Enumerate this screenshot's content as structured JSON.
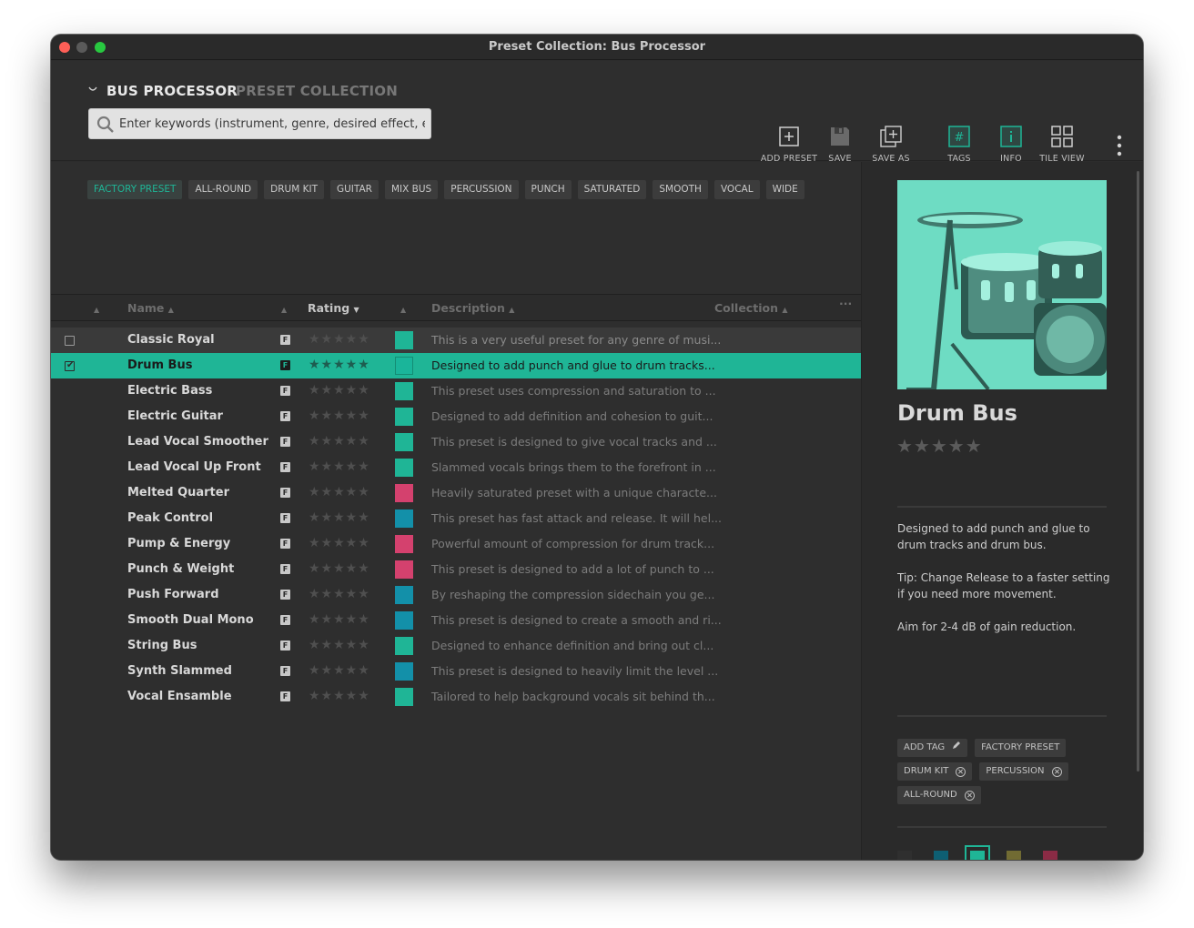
{
  "window": {
    "title": "Preset Collection: Bus Processor"
  },
  "header": {
    "product_name": "BUS PROCESSOR",
    "product_sub": "PRESET COLLECTION",
    "search_placeholder": "Enter keywords (instrument, genre, desired effect, etc.)"
  },
  "toolbar": {
    "add_preset": "ADD PRESET",
    "save": "SAVE",
    "save_as": "SAVE AS",
    "tags": "TAGS",
    "info": "INFO",
    "tile_view": "TILE VIEW"
  },
  "tag_filters": [
    {
      "label": "FACTORY PRESET",
      "active": true
    },
    {
      "label": "ALL-ROUND",
      "active": false
    },
    {
      "label": "DRUM KIT",
      "active": false
    },
    {
      "label": "GUITAR",
      "active": false
    },
    {
      "label": "MIX BUS",
      "active": false
    },
    {
      "label": "PERCUSSION",
      "active": false
    },
    {
      "label": "PUNCH",
      "active": false
    },
    {
      "label": "SATURATED",
      "active": false
    },
    {
      "label": "SMOOTH",
      "active": false
    },
    {
      "label": "VOCAL",
      "active": false
    },
    {
      "label": "WIDE",
      "active": false
    }
  ],
  "table": {
    "columns": {
      "name": "Name",
      "rating": "Rating",
      "description": "Description",
      "collection": "Collection"
    },
    "rows": [
      {
        "name": "Classic Royal",
        "badge": "F",
        "color": "#1fb596",
        "desc": "This is a very useful preset for any genre of musi...",
        "state": "hover",
        "checked": false
      },
      {
        "name": "Drum Bus",
        "badge": "F",
        "color": "#1ab59a",
        "desc": "Designed to add punch and glue to drum tracks...",
        "state": "selected",
        "checked": true
      },
      {
        "name": "Electric Bass",
        "badge": "F",
        "color": "#1fb596",
        "desc": "This preset uses compression and saturation to ...",
        "state": "",
        "checked": false
      },
      {
        "name": "Electric Guitar",
        "badge": "F",
        "color": "#1fb596",
        "desc": "Designed to add definition and cohesion to guit...",
        "state": "",
        "checked": false
      },
      {
        "name": "Lead Vocal Smoother",
        "badge": "F",
        "color": "#1fb596",
        "desc": "This preset is designed to give vocal tracks and ...",
        "state": "",
        "checked": false
      },
      {
        "name": "Lead Vocal Up Front",
        "badge": "F",
        "color": "#1fb596",
        "desc": "Slammed vocals brings them to the forefront in ...",
        "state": "",
        "checked": false
      },
      {
        "name": "Melted Quarter",
        "badge": "F",
        "color": "#d4416e",
        "desc": "Heavily saturated preset with a unique characte...",
        "state": "",
        "checked": false
      },
      {
        "name": "Peak Control",
        "badge": "F",
        "color": "#1390a9",
        "desc": "This preset has fast attack and release. It will hel...",
        "state": "",
        "checked": false
      },
      {
        "name": "Pump & Energy",
        "badge": "F",
        "color": "#d4416e",
        "desc": "Powerful amount of compression for drum track...",
        "state": "",
        "checked": false
      },
      {
        "name": "Punch & Weight",
        "badge": "F",
        "color": "#d4416e",
        "desc": "This preset is designed to add a lot of punch to ...",
        "state": "",
        "checked": false
      },
      {
        "name": "Push Forward",
        "badge": "F",
        "color": "#1390a9",
        "desc": "By reshaping the compression sidechain you ge...",
        "state": "",
        "checked": false
      },
      {
        "name": "Smooth Dual Mono",
        "badge": "F",
        "color": "#1390a9",
        "desc": "This preset is designed to create a smooth and ri...",
        "state": "",
        "checked": false
      },
      {
        "name": "String Bus",
        "badge": "F",
        "color": "#1fb596",
        "desc": "Designed to enhance definition and bring out cl...",
        "state": "",
        "checked": false
      },
      {
        "name": "Synth Slammed",
        "badge": "F",
        "color": "#1390a9",
        "desc": "This preset is designed to heavily limit the level ...",
        "state": "",
        "checked": false
      },
      {
        "name": "Vocal Ensamble",
        "badge": "F",
        "color": "#1fb596",
        "desc": "Tailored to help background vocals sit behind th...",
        "state": "",
        "checked": false
      }
    ]
  },
  "detail": {
    "title": "Drum Bus",
    "rating": "0 of 5 stars",
    "desc_1": "Designed to add punch and glue to drum tracks and drum bus.",
    "desc_2": "Tip: Change Release to a faster setting if you need more movement.",
    "desc_3": "Aim for 2-4 dB of gain reduction.",
    "add_tag": "ADD TAG",
    "tags": [
      "FACTORY PRESET",
      "DRUM KIT",
      "PERCUSSION",
      "ALL-ROUND"
    ],
    "colors": [
      "#2f2f2f",
      "#0e5f73",
      "#1fb596",
      "#716b33",
      "#8a2b45"
    ],
    "selected_color": "#1fb596"
  },
  "theme": {
    "accent": "#1fb596"
  }
}
